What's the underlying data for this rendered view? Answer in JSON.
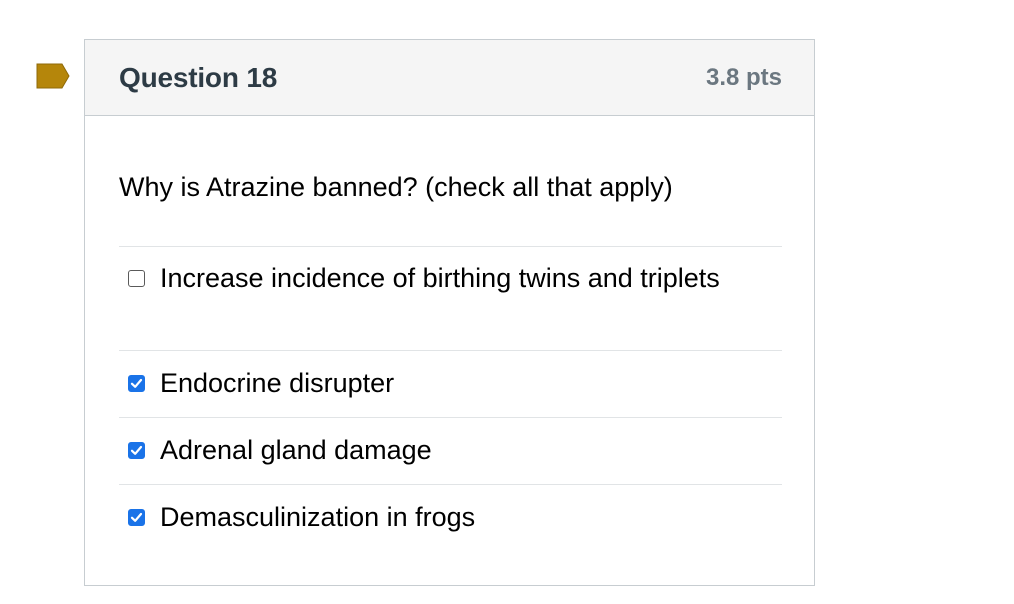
{
  "question": {
    "title": "Question 18",
    "points": "3.8 pts",
    "text": "Why is Atrazine banned? (check all that apply)",
    "flag_color": "#b5860b"
  },
  "answers": [
    {
      "label": "Increase incidence of birthing twins and triplets",
      "checked": false
    },
    {
      "label": "Endocrine disrupter",
      "checked": true
    },
    {
      "label": "Adrenal gland damage",
      "checked": true
    },
    {
      "label": "Demasculinization in frogs",
      "checked": true
    }
  ]
}
